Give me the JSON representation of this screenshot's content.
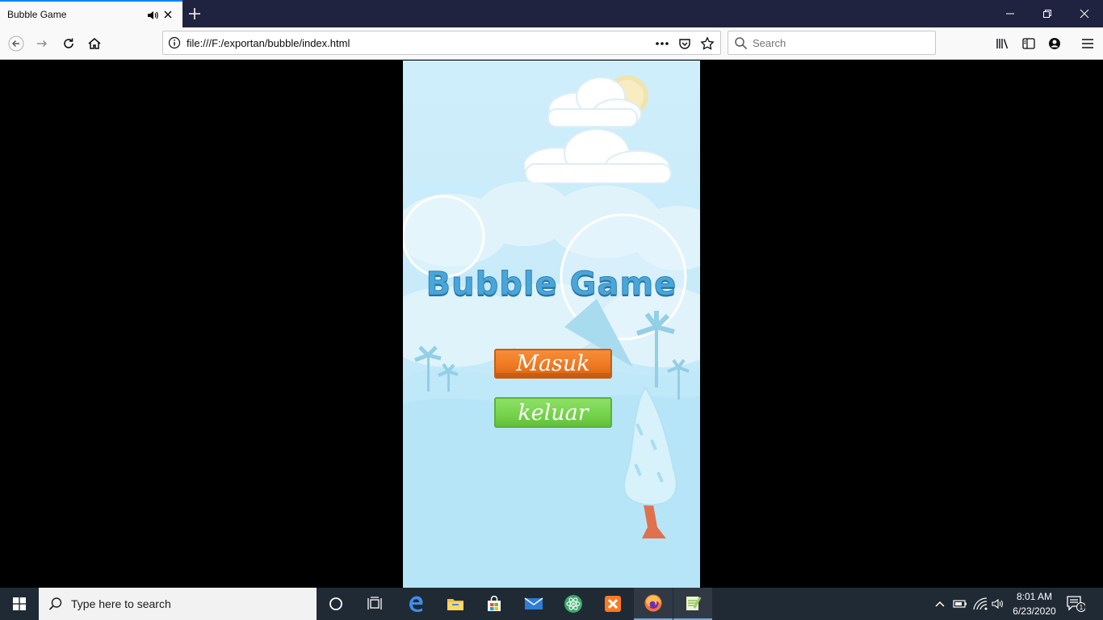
{
  "browser": {
    "tab_title": "Bubble Game",
    "url": "file:///F:/exportan/bubble/index.html",
    "search_placeholder": "Search"
  },
  "game": {
    "title": "Bubble Game",
    "buttons": {
      "enter": "Masuk",
      "exit": "keluar"
    },
    "colors": {
      "enter_button": "#ef7a22",
      "exit_button": "#74d24a",
      "sky": "#c7eaf9"
    }
  },
  "taskbar": {
    "search_placeholder": "Type here to search",
    "time": "8:01 AM",
    "date": "6/23/2020",
    "notification_count": "1"
  }
}
